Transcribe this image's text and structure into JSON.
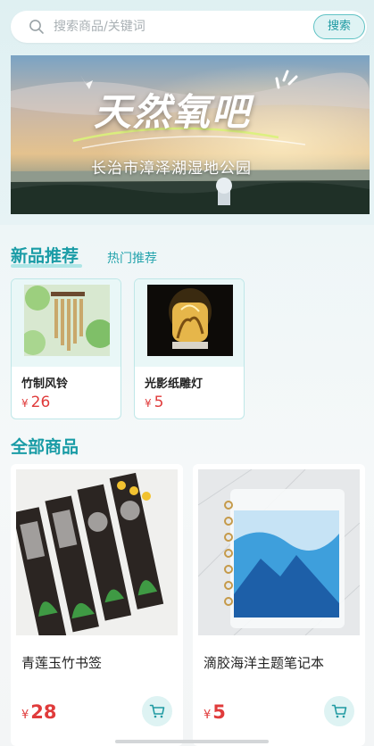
{
  "search": {
    "placeholder": "搜索商品/关键词",
    "button_label": "搜索"
  },
  "banner": {
    "title": "天然氧吧",
    "subtitle": "长治市漳泽湖湿地公园"
  },
  "tabs": {
    "active": "新品推荐",
    "inactive": "热门推荐"
  },
  "new_products": [
    {
      "name": "竹制风铃",
      "currency": "¥",
      "price": "26"
    },
    {
      "name": "光影纸雕灯",
      "currency": "¥",
      "price": "5"
    }
  ],
  "all_products_title": "全部商品",
  "products": [
    {
      "name": "青莲玉竹书签",
      "currency": "¥",
      "price": "28",
      "cart_icon": "cart-icon"
    },
    {
      "name": "滴胶海洋主题笔记本",
      "currency": "¥",
      "price": "5",
      "cart_icon": "cart-icon"
    }
  ],
  "colors": {
    "accent": "#1a9ca6",
    "price": "#e03b3b",
    "tab_underline": "#aee6e6"
  }
}
